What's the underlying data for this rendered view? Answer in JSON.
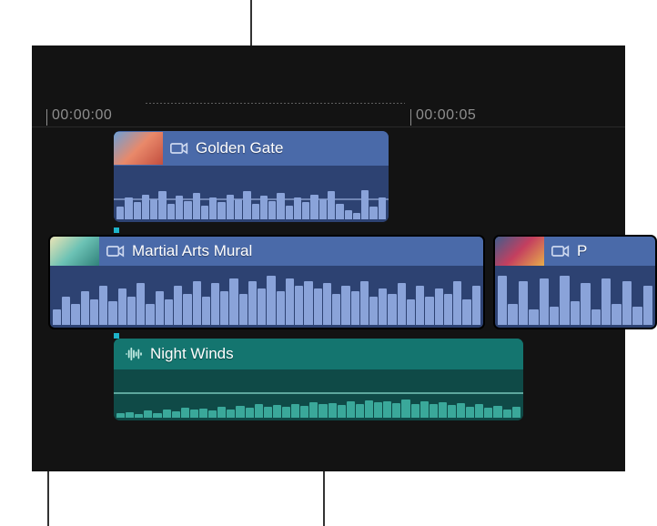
{
  "ruler": {
    "ticks": [
      {
        "pos": 48,
        "major": true,
        "label": "00:00:00"
      },
      {
        "pos": 448,
        "major": true,
        "label": "00:00:05"
      }
    ]
  },
  "clips": {
    "connected_video": {
      "label": "Golden Gate",
      "icon": "video-camera-icon"
    },
    "primary_mural": {
      "label": "Martial Arts Mural",
      "icon": "video-camera-icon"
    },
    "primary_right": {
      "label": "P",
      "icon": "video-camera-icon"
    },
    "connected_audio": {
      "label": "Night Winds",
      "icon": "audio-wave-icon"
    }
  },
  "colors": {
    "video_header": "#4a6aa9",
    "video_body": "#2d4272",
    "audio_header": "#14756f",
    "audio_body": "#0f4d4c"
  }
}
